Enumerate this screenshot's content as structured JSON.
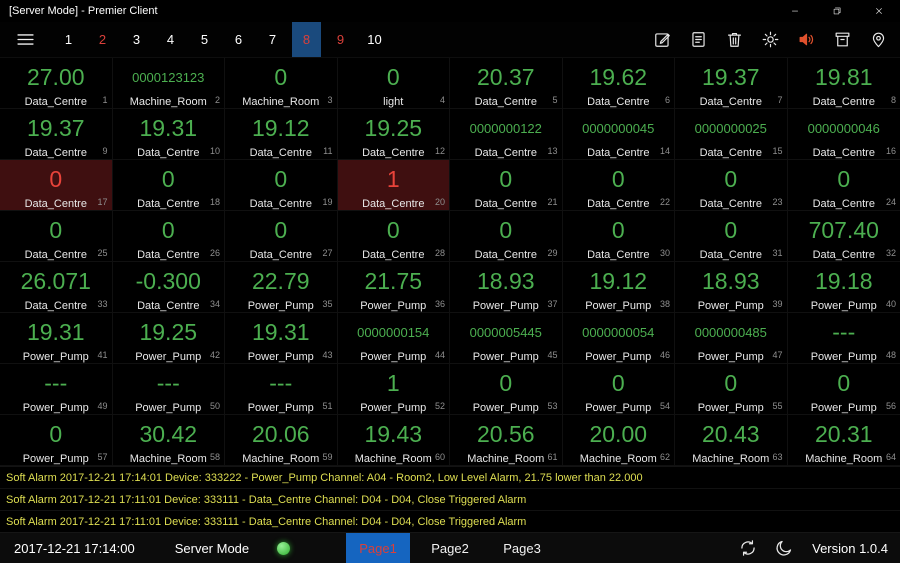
{
  "titlebar": {
    "title": "[Server Mode] - Premier Client",
    "controls": [
      "minimize-icon",
      "maximize-icon",
      "close-icon"
    ]
  },
  "toolbar": {
    "menu_icon": "menu-icon",
    "pages": [
      {
        "label": "1",
        "state": "normal"
      },
      {
        "label": "2",
        "state": "alarm"
      },
      {
        "label": "3",
        "state": "normal"
      },
      {
        "label": "4",
        "state": "normal"
      },
      {
        "label": "5",
        "state": "normal"
      },
      {
        "label": "6",
        "state": "normal"
      },
      {
        "label": "7",
        "state": "normal"
      },
      {
        "label": "8",
        "state": "selected"
      },
      {
        "label": "9",
        "state": "alarm"
      },
      {
        "label": "10",
        "state": "normal"
      }
    ],
    "action_icons": [
      "edit-icon",
      "report-icon",
      "delete-icon",
      "settings-icon",
      "speaker-icon",
      "archive-icon",
      "location-icon"
    ]
  },
  "grid": {
    "tiles": [
      {
        "value": "27.00",
        "label": "Data_Centre",
        "index": 1
      },
      {
        "value": "0000123123",
        "label": "Machine_Room",
        "index": 2
      },
      {
        "value": "0",
        "label": "Machine_Room",
        "index": 3
      },
      {
        "value": "0",
        "label": "light",
        "index": 4
      },
      {
        "value": "20.37",
        "label": "Data_Centre",
        "index": 5
      },
      {
        "value": "19.62",
        "label": "Data_Centre",
        "index": 6
      },
      {
        "value": "19.37",
        "label": "Data_Centre",
        "index": 7
      },
      {
        "value": "19.81",
        "label": "Data_Centre",
        "index": 8
      },
      {
        "value": "19.37",
        "label": "Data_Centre",
        "index": 9
      },
      {
        "value": "19.31",
        "label": "Data_Centre",
        "index": 10
      },
      {
        "value": "19.12",
        "label": "Data_Centre",
        "index": 11
      },
      {
        "value": "19.25",
        "label": "Data_Centre",
        "index": 12
      },
      {
        "value": "0000000122",
        "label": "Data_Centre",
        "index": 13
      },
      {
        "value": "0000000045",
        "label": "Data_Centre",
        "index": 14
      },
      {
        "value": "0000000025",
        "label": "Data_Centre",
        "index": 15
      },
      {
        "value": "0000000046",
        "label": "Data_Centre",
        "index": 16
      },
      {
        "value": "0",
        "label": "Data_Centre",
        "index": 17,
        "alarm": true
      },
      {
        "value": "0",
        "label": "Data_Centre",
        "index": 18
      },
      {
        "value": "0",
        "label": "Data_Centre",
        "index": 19
      },
      {
        "value": "1",
        "label": "Data_Centre",
        "index": 20,
        "alarm": true
      },
      {
        "value": "0",
        "label": "Data_Centre",
        "index": 21
      },
      {
        "value": "0",
        "label": "Data_Centre",
        "index": 22
      },
      {
        "value": "0",
        "label": "Data_Centre",
        "index": 23
      },
      {
        "value": "0",
        "label": "Data_Centre",
        "index": 24
      },
      {
        "value": "0",
        "label": "Data_Centre",
        "index": 25
      },
      {
        "value": "0",
        "label": "Data_Centre",
        "index": 26
      },
      {
        "value": "0",
        "label": "Data_Centre",
        "index": 27
      },
      {
        "value": "0",
        "label": "Data_Centre",
        "index": 28
      },
      {
        "value": "0",
        "label": "Data_Centre",
        "index": 29
      },
      {
        "value": "0",
        "label": "Data_Centre",
        "index": 30
      },
      {
        "value": "0",
        "label": "Data_Centre",
        "index": 31
      },
      {
        "value": "707.40",
        "label": "Data_Centre",
        "index": 32
      },
      {
        "value": "26.071",
        "label": "Data_Centre",
        "index": 33
      },
      {
        "value": "-0.300",
        "label": "Data_Centre",
        "index": 34
      },
      {
        "value": "22.79",
        "label": "Power_Pump",
        "index": 35
      },
      {
        "value": "21.75",
        "label": "Power_Pump",
        "index": 36
      },
      {
        "value": "18.93",
        "label": "Power_Pump",
        "index": 37
      },
      {
        "value": "19.12",
        "label": "Power_Pump",
        "index": 38
      },
      {
        "value": "18.93",
        "label": "Power_Pump",
        "index": 39
      },
      {
        "value": "19.18",
        "label": "Power_Pump",
        "index": 40
      },
      {
        "value": "19.31",
        "label": "Power_Pump",
        "index": 41
      },
      {
        "value": "19.25",
        "label": "Power_Pump",
        "index": 42
      },
      {
        "value": "19.31",
        "label": "Power_Pump",
        "index": 43
      },
      {
        "value": "0000000154",
        "label": "Power_Pump",
        "index": 44
      },
      {
        "value": "0000005445",
        "label": "Power_Pump",
        "index": 45
      },
      {
        "value": "0000000054",
        "label": "Power_Pump",
        "index": 46
      },
      {
        "value": "0000000485",
        "label": "Power_Pump",
        "index": 47
      },
      {
        "value": "---",
        "label": "Power_Pump",
        "index": 48
      },
      {
        "value": "---",
        "label": "Power_Pump",
        "index": 49
      },
      {
        "value": "---",
        "label": "Power_Pump",
        "index": 50
      },
      {
        "value": "---",
        "label": "Power_Pump",
        "index": 51
      },
      {
        "value": "1",
        "label": "Power_Pump",
        "index": 52
      },
      {
        "value": "0",
        "label": "Power_Pump",
        "index": 53
      },
      {
        "value": "0",
        "label": "Power_Pump",
        "index": 54
      },
      {
        "value": "0",
        "label": "Power_Pump",
        "index": 55
      },
      {
        "value": "0",
        "label": "Power_Pump",
        "index": 56
      },
      {
        "value": "0",
        "label": "Power_Pump",
        "index": 57
      },
      {
        "value": "30.42",
        "label": "Machine_Room",
        "index": 58
      },
      {
        "value": "20.06",
        "label": "Machine_Room",
        "index": 59
      },
      {
        "value": "19.43",
        "label": "Machine_Room",
        "index": 60
      },
      {
        "value": "20.56",
        "label": "Machine_Room",
        "index": 61
      },
      {
        "value": "20.00",
        "label": "Machine_Room",
        "index": 62
      },
      {
        "value": "20.43",
        "label": "Machine_Room",
        "index": 63
      },
      {
        "value": "20.31",
        "label": "Machine_Room",
        "index": 64
      }
    ]
  },
  "alarm_log": [
    {
      "text": "Soft Alarm 2017-12-21 17:14:01 Device: 333222 - Power_Pump Channel: A04 - Room2, Low Level Alarm, 21.75 lower than 22.000"
    },
    {
      "text": "Soft Alarm 2017-12-21 17:11:01 Device: 333111 - Data_Centre Channel: D04 - D04, Close Triggered Alarm"
    },
    {
      "text": "Soft Alarm 2017-12-21 17:11:01 Device: 333111 - Data_Centre Channel: D04 - D04, Close Triggered Alarm"
    }
  ],
  "statusbar": {
    "datetime": "2017-12-21 17:14:00",
    "mode": "Server Mode",
    "indicator": "online-green",
    "tabs": [
      {
        "label": "Page1",
        "selected": true
      },
      {
        "label": "Page2",
        "selected": false
      },
      {
        "label": "Page3",
        "selected": false
      }
    ],
    "icons": [
      "sync-icon",
      "moon-icon"
    ],
    "version": "Version 1.0.4"
  },
  "colors": {
    "value-green": "#4caf50",
    "value-red": "#e8433a",
    "alarm-bg": "#3f0f10",
    "alarm-text": "#dfdf52",
    "page-alarm": "#d9403a",
    "page-selected-bg": "#1a4a7d",
    "tab-selected-bg": "#1565c0",
    "speaker": "#e0512d",
    "status-green": "#2fae2f"
  }
}
